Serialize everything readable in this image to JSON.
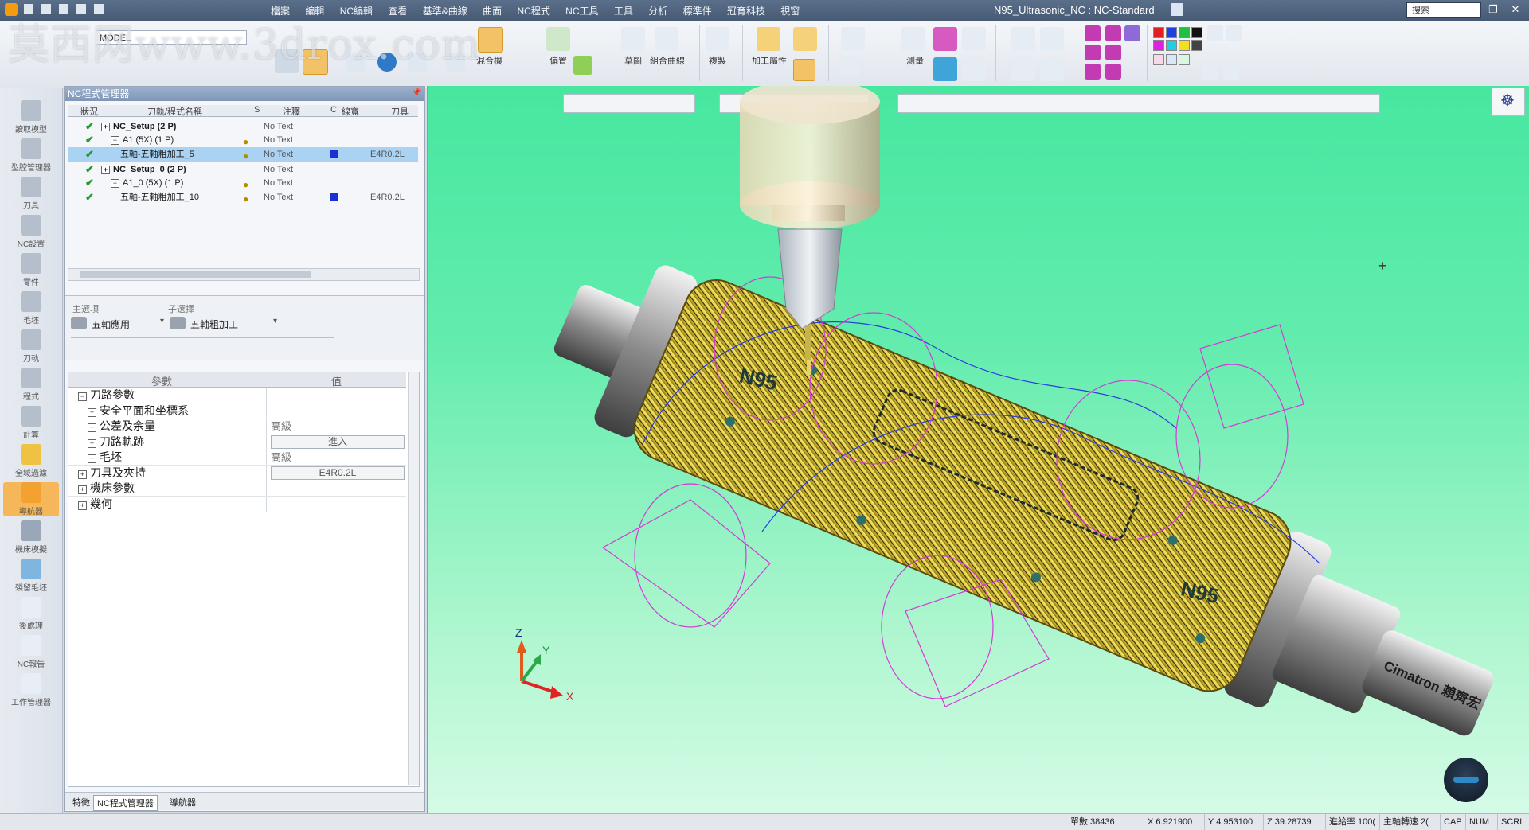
{
  "window": {
    "title": "N95_Ultrasonic_NC : NC-Standard",
    "search_placeholder": "搜索"
  },
  "menu": [
    "檔案",
    "編輯",
    "NC編輯",
    "查看",
    "基準&曲線",
    "曲面",
    "NC程式",
    "NC工具",
    "工具",
    "分析",
    "標準件",
    "冠育科技",
    "視窗"
  ],
  "watermark": "莫西网www.3drox.com",
  "ribbon": {
    "model_field": "MODEL",
    "labels": [
      "混合機",
      "偏置",
      "草圖",
      "組合曲線",
      "複製",
      "加工屬性",
      "測量"
    ]
  },
  "leftnav": [
    {
      "label": "讀取模型",
      "icon": "load-model-icon"
    },
    {
      "label": "型腔管理器",
      "icon": "cavity-manager-icon"
    },
    {
      "label": "刀具",
      "icon": "tool-icon"
    },
    {
      "label": "NC設置",
      "icon": "nc-setup-icon"
    },
    {
      "label": "零件",
      "icon": "part-icon"
    },
    {
      "label": "毛坯",
      "icon": "stock-icon"
    },
    {
      "label": "刀軌",
      "icon": "toolpath-icon"
    },
    {
      "label": "程式",
      "icon": "program-icon"
    },
    {
      "label": "計算",
      "icon": "compute-icon"
    },
    {
      "label": "全域過濾",
      "icon": "global-filter-icon"
    },
    {
      "label": "導航器",
      "icon": "navigator-icon"
    },
    {
      "label": "機床模擬",
      "icon": "machine-sim-icon"
    },
    {
      "label": "殘留毛坯",
      "icon": "remaining-stock-icon"
    },
    {
      "label": "後處理",
      "icon": "post-process-icon"
    },
    {
      "label": "NC報告",
      "icon": "nc-report-icon"
    },
    {
      "label": "工作管理器",
      "icon": "job-manager-icon"
    }
  ],
  "nc_manager": {
    "title": "NC程式管理器",
    "columns": [
      "狀況",
      "刀軌/程式名稱",
      "S",
      "注釋",
      "C",
      "線寬",
      "刀具"
    ],
    "rows": [
      {
        "name": "NC_Setup (2 P)",
        "note": "No Text",
        "tool": "",
        "level": 0,
        "expander": "+",
        "bold": true
      },
      {
        "name": "A1 (5X) (1 P)",
        "note": "No Text",
        "tool": "",
        "level": 1,
        "expander": "−",
        "bold": false
      },
      {
        "name": "五軸-五軸粗加工_5",
        "note": "No Text",
        "tool": "E4R0.2L",
        "level": 2,
        "expander": "",
        "bold": false,
        "selected": true
      },
      {
        "name": "NC_Setup_0 (2 P)",
        "note": "No Text",
        "tool": "",
        "level": 0,
        "expander": "+",
        "bold": true
      },
      {
        "name": "A1_0 (5X) (1 P)",
        "note": "No Text",
        "tool": "",
        "level": 1,
        "expander": "−",
        "bold": false
      },
      {
        "name": "五軸-五軸粗加工_10",
        "note": "No Text",
        "tool": "E4R0.2L",
        "level": 2,
        "expander": "",
        "bold": false
      }
    ],
    "main_choice_label": "主選項",
    "sub_choice_label": "子選擇",
    "main_choice": "五軸應用",
    "sub_choice": "五軸粗加工",
    "param_header": [
      "參數",
      "值"
    ],
    "params": [
      {
        "label": "刀路參數",
        "value": "",
        "indent": 1,
        "expander": "−"
      },
      {
        "label": "安全平面和坐標系",
        "value": "",
        "indent": 2,
        "expander": "+"
      },
      {
        "label": "公差及余量",
        "value": "高級",
        "indent": 2,
        "expander": "+"
      },
      {
        "label": "刀路軌跡",
        "value": "進入",
        "indent": 2,
        "expander": "+",
        "box": true
      },
      {
        "label": "毛坯",
        "value": "高級",
        "indent": 2,
        "expander": "+"
      },
      {
        "label": "刀具及夾持",
        "value": "E4R0.2L",
        "indent": 1,
        "expander": "+",
        "box": true
      },
      {
        "label": "機床參數",
        "value": "",
        "indent": 1,
        "expander": "+"
      },
      {
        "label": "幾何",
        "value": "",
        "indent": 1,
        "expander": "+"
      }
    ],
    "tabs": [
      "特徵",
      "NC程式管理器",
      "導航器"
    ]
  },
  "viewport": {
    "engraving_1": "N95",
    "engraving_2": "N95",
    "shaft_text": "Cimatron 賴齊宏",
    "axis_x": "X",
    "axis_y": "Y",
    "axis_z": "Z"
  },
  "status": {
    "count": "單數 38436",
    "x": "X 6.921900",
    "y": "Y 4.953100",
    "z": "Z 39.28739",
    "scale": "進給率 100(",
    "spindle": "主軸轉速 2(",
    "cap": "CAP",
    "num": "NUM",
    "scrl": "SCRL"
  },
  "colors": {
    "viewport_bg_top": "#47e7a0",
    "viewport_bg_bottom": "#d5fbe6",
    "toolpath_yellow": "#f2e24a",
    "toolpath_magenta": "#d33ad6",
    "toolpath_blue": "#2a3de0",
    "title_bar": "#4f6480"
  }
}
